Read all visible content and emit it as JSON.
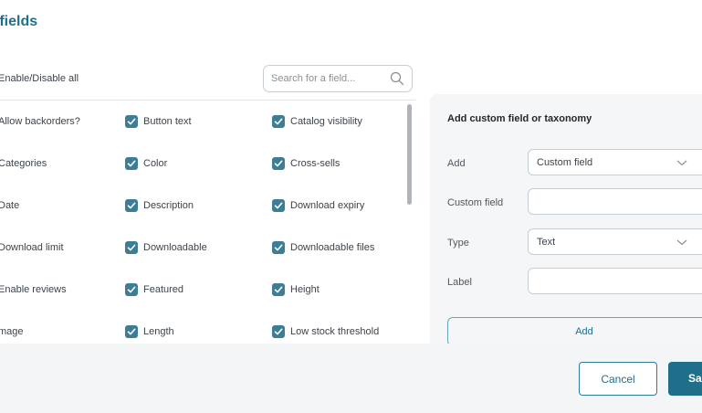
{
  "header": {
    "title": "e fields"
  },
  "list": {
    "enable_all_label": "Enable/Disable all",
    "search_placeholder": "Search for a field...",
    "rows": [
      {
        "cells": [
          {
            "label": "Allow backorders?",
            "checked": false
          },
          {
            "label": "Button text",
            "checked": true
          },
          {
            "label": "Catalog visibility",
            "checked": true
          }
        ]
      },
      {
        "cells": [
          {
            "label": "Categories",
            "checked": false
          },
          {
            "label": "Color",
            "checked": true
          },
          {
            "label": "Cross-sells",
            "checked": true
          }
        ]
      },
      {
        "cells": [
          {
            "label": "Date",
            "checked": false
          },
          {
            "label": "Description",
            "checked": true
          },
          {
            "label": "Download expiry",
            "checked": true
          }
        ]
      },
      {
        "cells": [
          {
            "label": "Download limit",
            "checked": false
          },
          {
            "label": "Downloadable",
            "checked": true
          },
          {
            "label": "Downloadable files",
            "checked": true
          }
        ]
      },
      {
        "cells": [
          {
            "label": "Enable reviews",
            "checked": false
          },
          {
            "label": "Featured",
            "checked": true
          },
          {
            "label": "Height",
            "checked": true
          }
        ]
      },
      {
        "cells": [
          {
            "label": "mage",
            "checked": false
          },
          {
            "label": "Length",
            "checked": true
          },
          {
            "label": "Low stock threshold",
            "checked": true
          }
        ]
      }
    ]
  },
  "custom_panel": {
    "title": "Add custom field or taxonomy",
    "add_label": "Add",
    "add_value": "Custom field",
    "custom_field_label": "Custom field",
    "custom_field_value": "",
    "type_label": "Type",
    "type_value": "Text",
    "label_label": "Label",
    "label_value": "",
    "add_button": "Add"
  },
  "footer": {
    "cancel": "Cancel",
    "save": "Sa"
  },
  "colors": {
    "accent": "#1f6f8b",
    "checkbox": "#3e7d96",
    "panel_bg": "#f5f6f7"
  }
}
